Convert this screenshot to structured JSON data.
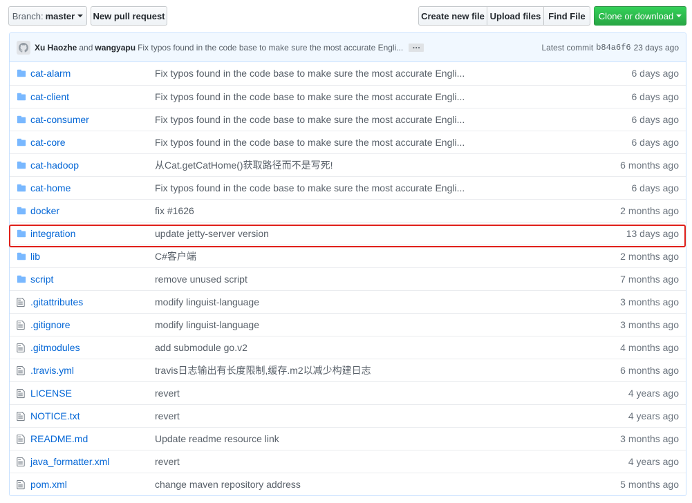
{
  "toolbar": {
    "branch_label": "Branch:",
    "branch_value": "master",
    "new_pr": "New pull request",
    "create_file": "Create new file",
    "upload_files": "Upload files",
    "find_file": "Find File",
    "clone": "Clone or download"
  },
  "commit": {
    "author1": "Xu Haozhe",
    "and": "and",
    "author2": "wangyapu",
    "message": "Fix typos found in the code base to make sure the most accurate Engli...",
    "ellipsis": "…",
    "latest_label": "Latest commit",
    "sha": "b84a6f6",
    "age": "23 days ago"
  },
  "files": [
    {
      "type": "dir",
      "icon": "folder-icon",
      "name": "cat-alarm",
      "message": "Fix typos found in the code base to make sure the most accurate Engli...",
      "age": "6 days ago"
    },
    {
      "type": "dir",
      "icon": "folder-icon",
      "name": "cat-client",
      "message": "Fix typos found in the code base to make sure the most accurate Engli...",
      "age": "6 days ago"
    },
    {
      "type": "dir",
      "icon": "folder-icon",
      "name": "cat-consumer",
      "message": "Fix typos found in the code base to make sure the most accurate Engli...",
      "age": "6 days ago"
    },
    {
      "type": "dir",
      "icon": "folder-icon",
      "name": "cat-core",
      "message": "Fix typos found in the code base to make sure the most accurate Engli...",
      "age": "6 days ago"
    },
    {
      "type": "dir",
      "icon": "folder-icon",
      "name": "cat-hadoop",
      "message": "从Cat.getCatHome()获取路径而不是写死!",
      "age": "6 months ago"
    },
    {
      "type": "dir",
      "icon": "folder-icon",
      "name": "cat-home",
      "message": "Fix typos found in the code base to make sure the most accurate Engli...",
      "age": "6 days ago"
    },
    {
      "type": "dir",
      "icon": "folder-icon",
      "name": "docker",
      "message": "fix #1626",
      "age": "2 months ago"
    },
    {
      "type": "dir",
      "icon": "folder-icon",
      "name": "integration",
      "message": "update jetty-server version",
      "age": "13 days ago"
    },
    {
      "type": "dir",
      "icon": "folder-icon",
      "name": "lib",
      "message": "C#客户端",
      "age": "2 months ago"
    },
    {
      "type": "dir",
      "icon": "folder-icon",
      "name": "script",
      "message": "remove unused script",
      "age": "7 months ago"
    },
    {
      "type": "file",
      "icon": "file-icon",
      "name": ".gitattributes",
      "message": "modify linguist-language",
      "age": "3 months ago"
    },
    {
      "type": "file",
      "icon": "file-icon",
      "name": ".gitignore",
      "message": "modify linguist-language",
      "age": "3 months ago"
    },
    {
      "type": "file",
      "icon": "file-icon",
      "name": ".gitmodules",
      "message": "add submodule go.v2",
      "age": "4 months ago"
    },
    {
      "type": "file",
      "icon": "file-icon",
      "name": ".travis.yml",
      "message": "travis日志输出有长度限制,缓存.m2以减少构建日志",
      "age": "6 months ago"
    },
    {
      "type": "file",
      "icon": "file-icon",
      "name": "LICENSE",
      "message": "revert",
      "age": "4 years ago"
    },
    {
      "type": "file",
      "icon": "file-icon",
      "name": "NOTICE.txt",
      "message": "revert",
      "age": "4 years ago"
    },
    {
      "type": "file",
      "icon": "file-icon",
      "name": "README.md",
      "message": "Update readme resource link",
      "age": "3 months ago"
    },
    {
      "type": "file",
      "icon": "file-icon",
      "name": "java_formatter.xml",
      "message": "revert",
      "age": "4 years ago"
    },
    {
      "type": "file",
      "icon": "file-icon",
      "name": "pom.xml",
      "message": "change maven repository address",
      "age": "5 months ago"
    }
  ],
  "highlight_color": "#e0201a",
  "link_color": "#0366d6",
  "folder_color": "#79b8ff"
}
